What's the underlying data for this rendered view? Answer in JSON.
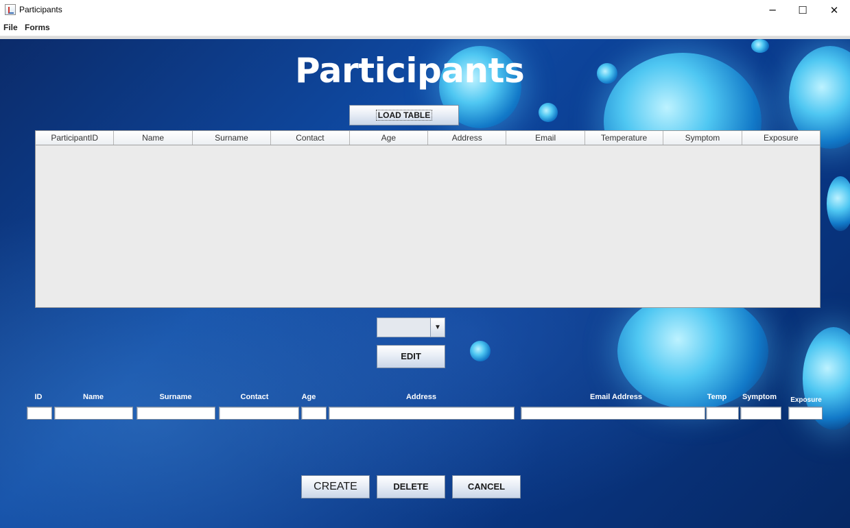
{
  "window": {
    "title": "Participants",
    "minimize_glyph": "─",
    "maximize_glyph": "☐",
    "close_glyph": "✕"
  },
  "menu": {
    "file": "File",
    "forms": "Forms"
  },
  "page_title": "Participants",
  "load_table_label": "LOAD TABLE",
  "table": {
    "columns": [
      "ParticipantID",
      "Name",
      "Surname",
      "Contact",
      "Age",
      "Address",
      "Email",
      "Temperature",
      "Symptom",
      "Exposure"
    ],
    "rows": []
  },
  "selector": {
    "value": "",
    "arrow": "▼"
  },
  "edit_label": "EDIT",
  "form": {
    "id_label": "ID",
    "name_label": "Name",
    "surname_label": "Surname",
    "contact_label": "Contact",
    "age_label": "Age",
    "address_label": "Address",
    "email_label": "Email Address",
    "temp_label": "Temp",
    "symptom_label": "Symptom",
    "exposure_label": "Exposure"
  },
  "actions": {
    "create": "CREATE",
    "delete": "DELETE",
    "cancel": "CANCEL"
  },
  "colors": {
    "background": "#0f4aa3",
    "virus": "#4fc7f2",
    "button_top": "#ffffff",
    "button_bottom": "#c9d6e8"
  },
  "icons": {
    "app": "java-app-icon",
    "dropdown": "chevron-down-icon"
  }
}
